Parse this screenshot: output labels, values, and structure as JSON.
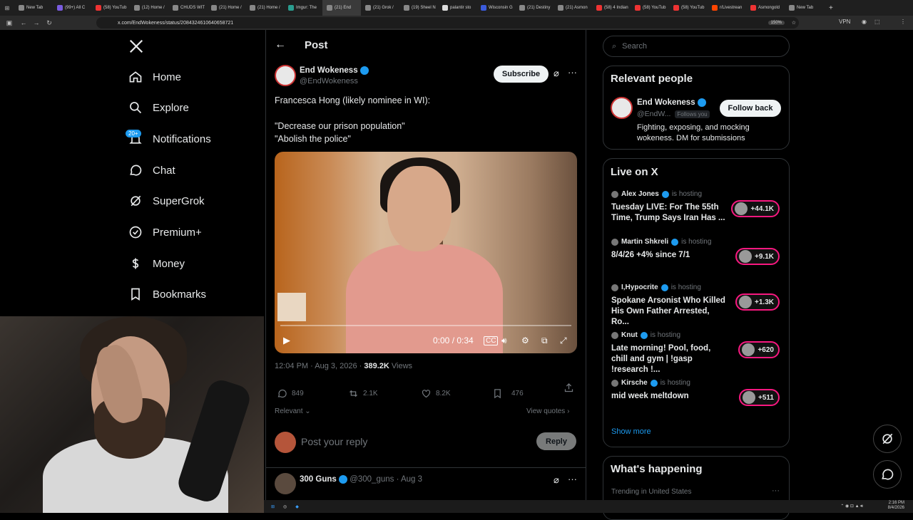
{
  "browser": {
    "tabs": [
      "New Tab",
      "(99+) All C",
      "(58) YouTub",
      "(12) Home /",
      "CHUDS WIT",
      "(21) Home /",
      "(21) Home /",
      "Imgur: The",
      "(21) End",
      "(21) Grok /",
      "(19) Sheel N",
      "palantir sto",
      "Wisconsin G",
      "(21) Destiny",
      "(21) Asmon",
      "(58) 4 Indian",
      "(58) YouTub",
      "(58) YouTub",
      "r/Livestrean",
      "Asmongold",
      "New Tab"
    ],
    "tab_colors": [
      "#888",
      "#7a5ce0",
      "#e33",
      "#888",
      "#888",
      "#888",
      "#888",
      "#2a9d8f",
      "#888",
      "#888",
      "#888",
      "#ddd",
      "#3b5bdb",
      "#888",
      "#888",
      "#e33",
      "#e33",
      "#e33",
      "#ff4500",
      "#e33",
      "#888"
    ],
    "url": "x.com/EndWokeness/status/2084324610640658721",
    "zoom": "150%",
    "vpn": "VPN"
  },
  "nav": {
    "home": "Home",
    "explore": "Explore",
    "notifications": "Notifications",
    "notif_badge": "20+",
    "chat": "Chat",
    "supergrok": "SuperGrok",
    "premium": "Premium+",
    "money": "Money",
    "bookmarks": "Bookmarks"
  },
  "post": {
    "header": "Post",
    "author": "End Wokeness",
    "handle": "@EndWokeness",
    "subscribe": "Subscribe",
    "text_line1": "Francesca Hong (likely nominee in WI):",
    "text_line2": "\"Decrease our prison population\"",
    "text_line3": "\"Abolish the police\"",
    "video_time": "0:00 / 0:34",
    "timestamp": "12:04 PM · Aug 3, 2026 · ",
    "views_count": "389.2K",
    "views_label": "Views",
    "replies": "849",
    "reposts": "2.1K",
    "likes": "8.2K",
    "bookmarks": "476",
    "sort": "Relevant",
    "view_quotes": "View quotes",
    "reply_placeholder": "Post your reply",
    "reply_button": "Reply",
    "next_author": "300 Guns",
    "next_handle": "@300_guns · Aug 3"
  },
  "sidebar": {
    "search_placeholder": "Search",
    "relevant_title": "Relevant people",
    "person_name": "End Wokeness",
    "person_handle": "@EndW...",
    "follows_you": "Follows you",
    "follow_back": "Follow back",
    "bio": "Fighting, exposing, and mocking wokeness. DM for submissions",
    "live_title": "Live on X",
    "live": [
      {
        "host": "Alex Jones",
        "hosting": "is hosting",
        "title": "Tuesday LIVE: For The 55th Time, Trump Says Iran Has ...",
        "count": "+44.1K"
      },
      {
        "host": "Martin Shkreli",
        "hosting": "is hosting",
        "title": "8/4/26 +4% since 7/1",
        "count": "+9.1K"
      },
      {
        "host": "I,Hypocrite",
        "hosting": "is hosting",
        "title": "Spokane Arsonist Who Killed His Own Father Arrested, Ro...",
        "count": "+1.3K"
      },
      {
        "host": "Knut",
        "hosting": "is hosting",
        "title": "Late morning! Pool, food, chill and gym | !gasp !research !...",
        "count": "+620"
      },
      {
        "host": "Kirsche",
        "hosting": "is hosting",
        "title": "mid week meltdown",
        "count": "+511"
      }
    ],
    "show_more": "Show more",
    "happening_title": "What's happening",
    "trending": "Trending in United States"
  },
  "taskbar": {
    "time": "2:16 PM",
    "date": "8/4/2026"
  }
}
